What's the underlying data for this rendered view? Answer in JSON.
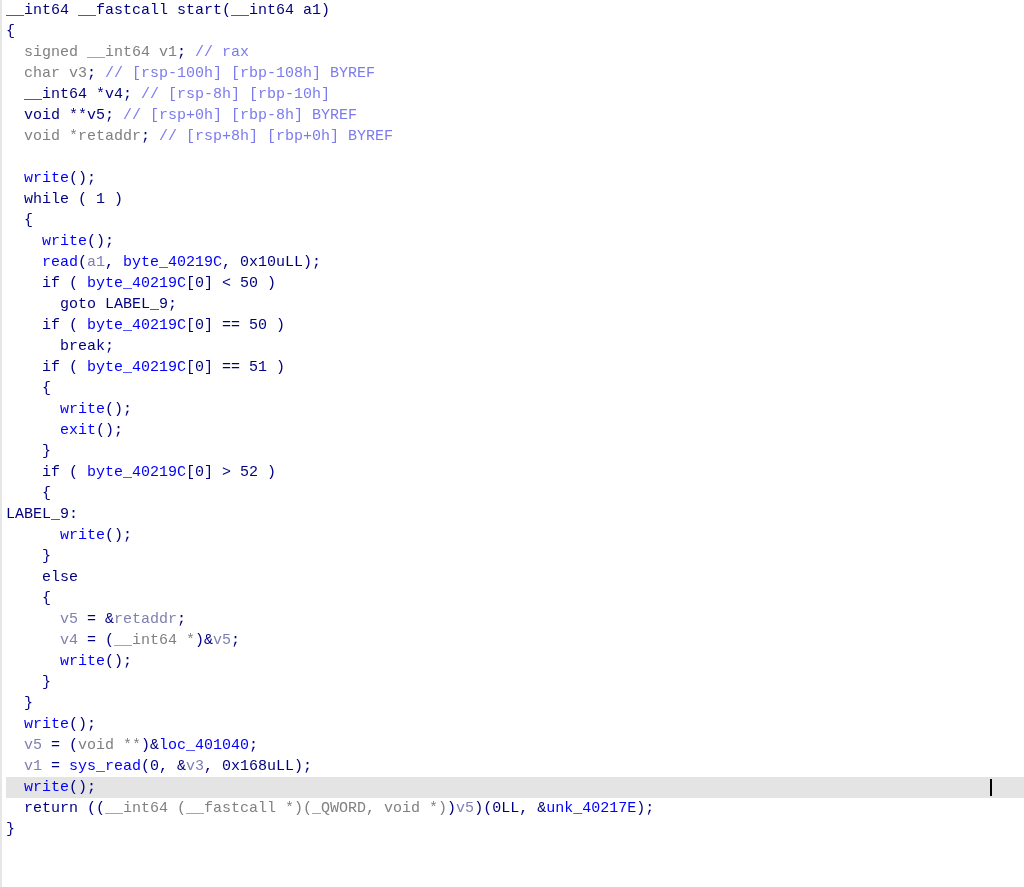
{
  "code_lines": [
    {
      "current": false,
      "tokens": [
        {
          "kind": "plain",
          "text": "__int64 __fastcall start(__int64 a1)"
        }
      ]
    },
    {
      "current": false,
      "tokens": [
        {
          "kind": "plain",
          "text": "{"
        }
      ]
    },
    {
      "current": false,
      "tokens": [
        {
          "kind": "type",
          "text": "  signed __int64 v1"
        },
        {
          "kind": "plain",
          "text": ";"
        },
        {
          "kind": "comment",
          "text": " // rax"
        }
      ]
    },
    {
      "current": false,
      "tokens": [
        {
          "kind": "type",
          "text": "  char v3"
        },
        {
          "kind": "plain",
          "text": ";"
        },
        {
          "kind": "comment",
          "text": " // [rsp-100h] [rbp-108h] BYREF"
        }
      ]
    },
    {
      "current": false,
      "tokens": [
        {
          "kind": "plain",
          "text": "  __int64 *v4;"
        },
        {
          "kind": "comment",
          "text": " // [rsp-8h] [rbp-10h]"
        }
      ]
    },
    {
      "current": false,
      "tokens": [
        {
          "kind": "plain",
          "text": "  void **v5;"
        },
        {
          "kind": "comment",
          "text": " // [rsp+0h] [rbp-8h] BYREF"
        }
      ]
    },
    {
      "current": false,
      "tokens": [
        {
          "kind": "type",
          "text": "  void *retaddr"
        },
        {
          "kind": "plain",
          "text": ";"
        },
        {
          "kind": "comment",
          "text": " // [rsp+8h] [rbp+0h] BYREF"
        }
      ]
    },
    {
      "current": false
    },
    {
      "current": false,
      "tokens": [
        {
          "kind": "func",
          "text": "  write"
        },
        {
          "kind": "plain",
          "text": "();"
        }
      ]
    },
    {
      "current": false,
      "tokens": [
        {
          "kind": "plain",
          "text": "  while ( 1 )"
        }
      ]
    },
    {
      "current": false,
      "tokens": [
        {
          "kind": "plain",
          "text": "  {"
        }
      ]
    },
    {
      "current": false,
      "tokens": [
        {
          "kind": "func",
          "text": "    write"
        },
        {
          "kind": "plain",
          "text": "();"
        }
      ]
    },
    {
      "current": false,
      "tokens": [
        {
          "kind": "func",
          "text": "    read"
        },
        {
          "kind": "plain",
          "text": "("
        },
        {
          "kind": "var",
          "text": "a1"
        },
        {
          "kind": "plain",
          "text": ", "
        },
        {
          "kind": "func",
          "text": "byte_40219C"
        },
        {
          "kind": "plain",
          "text": ", 0x10uLL);"
        }
      ]
    },
    {
      "current": false,
      "tokens": [
        {
          "kind": "plain",
          "text": "    if ( "
        },
        {
          "kind": "func",
          "text": "byte_40219C"
        },
        {
          "kind": "plain",
          "text": "[0] < 50 )"
        }
      ]
    },
    {
      "current": false,
      "tokens": [
        {
          "kind": "plain",
          "text": "      goto LABEL_9;"
        }
      ]
    },
    {
      "current": false,
      "tokens": [
        {
          "kind": "plain",
          "text": "    if ( "
        },
        {
          "kind": "func",
          "text": "byte_40219C"
        },
        {
          "kind": "plain",
          "text": "[0] == 50 )"
        }
      ]
    },
    {
      "current": false,
      "tokens": [
        {
          "kind": "plain",
          "text": "      break;"
        }
      ]
    },
    {
      "current": false,
      "tokens": [
        {
          "kind": "plain",
          "text": "    if ( "
        },
        {
          "kind": "func",
          "text": "byte_40219C"
        },
        {
          "kind": "plain",
          "text": "[0] == 51 )"
        }
      ]
    },
    {
      "current": false,
      "tokens": [
        {
          "kind": "plain",
          "text": "    {"
        }
      ]
    },
    {
      "current": false,
      "tokens": [
        {
          "kind": "func",
          "text": "      write"
        },
        {
          "kind": "plain",
          "text": "();"
        }
      ]
    },
    {
      "current": false,
      "tokens": [
        {
          "kind": "func",
          "text": "      exit"
        },
        {
          "kind": "plain",
          "text": "();"
        }
      ]
    },
    {
      "current": false,
      "tokens": [
        {
          "kind": "plain",
          "text": "    }"
        }
      ]
    },
    {
      "current": false,
      "tokens": [
        {
          "kind": "plain",
          "text": "    if ( "
        },
        {
          "kind": "func",
          "text": "byte_40219C"
        },
        {
          "kind": "plain",
          "text": "[0] > 52 )"
        }
      ]
    },
    {
      "current": false,
      "tokens": [
        {
          "kind": "plain",
          "text": "    {"
        }
      ]
    },
    {
      "current": false,
      "tokens": [
        {
          "kind": "plain",
          "text": "LABEL_9:"
        }
      ]
    },
    {
      "current": false,
      "tokens": [
        {
          "kind": "func",
          "text": "      write"
        },
        {
          "kind": "plain",
          "text": "();"
        }
      ]
    },
    {
      "current": false,
      "tokens": [
        {
          "kind": "plain",
          "text": "    }"
        }
      ]
    },
    {
      "current": false,
      "tokens": [
        {
          "kind": "plain",
          "text": "    else"
        }
      ]
    },
    {
      "current": false,
      "tokens": [
        {
          "kind": "plain",
          "text": "    {"
        }
      ]
    },
    {
      "current": false,
      "tokens": [
        {
          "kind": "var",
          "text": "      v5"
        },
        {
          "kind": "plain",
          "text": " = &"
        },
        {
          "kind": "var",
          "text": "retaddr"
        },
        {
          "kind": "plain",
          "text": ";"
        }
      ]
    },
    {
      "current": false,
      "tokens": [
        {
          "kind": "var",
          "text": "      v4"
        },
        {
          "kind": "plain",
          "text": " = ("
        },
        {
          "kind": "type",
          "text": "__int64 *"
        },
        {
          "kind": "plain",
          "text": ")&"
        },
        {
          "kind": "var",
          "text": "v5"
        },
        {
          "kind": "plain",
          "text": ";"
        }
      ]
    },
    {
      "current": false,
      "tokens": [
        {
          "kind": "func",
          "text": "      write"
        },
        {
          "kind": "plain",
          "text": "();"
        }
      ]
    },
    {
      "current": false,
      "tokens": [
        {
          "kind": "plain",
          "text": "    }"
        }
      ]
    },
    {
      "current": false,
      "tokens": [
        {
          "kind": "plain",
          "text": "  }"
        }
      ]
    },
    {
      "current": false,
      "tokens": [
        {
          "kind": "func",
          "text": "  write"
        },
        {
          "kind": "plain",
          "text": "();"
        }
      ]
    },
    {
      "current": false,
      "tokens": [
        {
          "kind": "var",
          "text": "  v5"
        },
        {
          "kind": "plain",
          "text": " = ("
        },
        {
          "kind": "type",
          "text": "void **"
        },
        {
          "kind": "plain",
          "text": ")&"
        },
        {
          "kind": "func",
          "text": "loc_401040"
        },
        {
          "kind": "plain",
          "text": ";"
        }
      ]
    },
    {
      "current": false,
      "tokens": [
        {
          "kind": "var",
          "text": "  v1"
        },
        {
          "kind": "plain",
          "text": " = "
        },
        {
          "kind": "func",
          "text": "sys_read"
        },
        {
          "kind": "plain",
          "text": "(0, &"
        },
        {
          "kind": "var",
          "text": "v3"
        },
        {
          "kind": "plain",
          "text": ", 0x168uLL);"
        }
      ]
    },
    {
      "current": true,
      "tokens": [
        {
          "kind": "func",
          "text": "  write"
        },
        {
          "kind": "plain",
          "text": "();"
        }
      ]
    },
    {
      "current": false,
      "tokens": [
        {
          "kind": "plain",
          "text": "  return (("
        },
        {
          "kind": "type",
          "text": "__int64 (__fastcall *)(_QWORD, void *)"
        },
        {
          "kind": "plain",
          "text": ")"
        },
        {
          "kind": "var",
          "text": "v5"
        },
        {
          "kind": "plain",
          "text": ")(0LL, &"
        },
        {
          "kind": "func",
          "text": "unk_40217E"
        },
        {
          "kind": "plain",
          "text": ");"
        }
      ]
    },
    {
      "current": false,
      "tokens": [
        {
          "kind": "plain",
          "text": "}"
        }
      ]
    }
  ]
}
